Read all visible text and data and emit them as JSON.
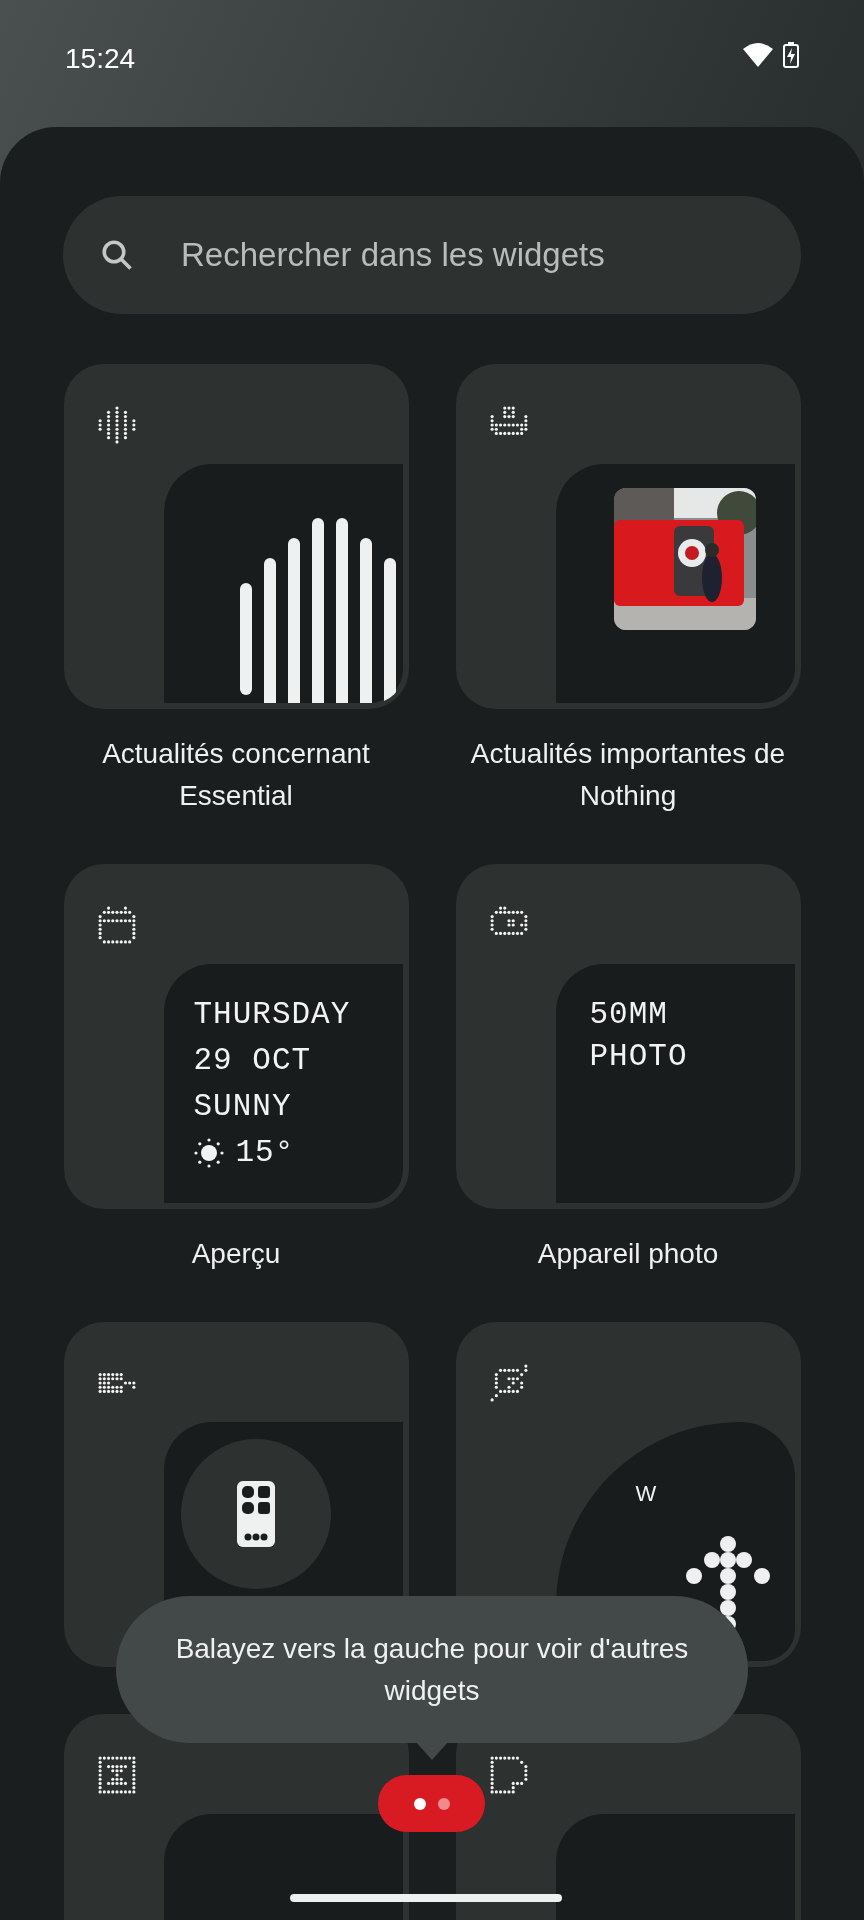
{
  "status_bar": {
    "time": "15:24"
  },
  "search": {
    "placeholder": "Rechercher dans les widgets"
  },
  "widgets": [
    {
      "kind": "waveform",
      "label": "Actualités concernant Essential"
    },
    {
      "kind": "picture",
      "label": "Actualités importantes de Nothing"
    },
    {
      "kind": "date",
      "label": "Aperçu",
      "lines": [
        "THURSDAY",
        "29 OCT",
        "SUNNY"
      ],
      "temperature": "15°"
    },
    {
      "kind": "camera",
      "label": "Appareil photo",
      "lines": [
        "50MM",
        "PHOTO"
      ]
    },
    {
      "kind": "battery"
    },
    {
      "kind": "compass",
      "direction": "W"
    },
    {
      "kind": "timer"
    },
    {
      "kind": "note"
    }
  ],
  "tooltip": {
    "text": "Balayez vers la gauche pour voir d'autres widgets"
  },
  "pager": {
    "dots": [
      {
        "selected": true
      },
      {
        "selected": false
      }
    ]
  }
}
